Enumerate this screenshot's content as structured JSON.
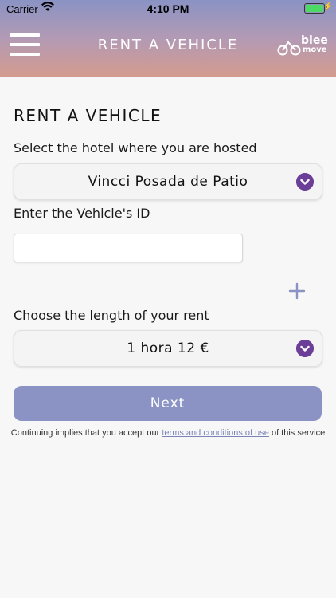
{
  "status_bar": {
    "carrier": "Carrier",
    "time": "4:10 PM",
    "battery_level": 1.0
  },
  "header": {
    "title": "RENT A VEHICLE",
    "logo_text_top": "blee",
    "logo_text_bottom": "move",
    "menu_icon": "hamburger-menu-icon"
  },
  "form": {
    "section_title": "RENT A VEHICLE",
    "hotel_label": "Select the hotel where you are hosted",
    "hotel_value": "Vincci Posada de Patio",
    "vehicle_id_label": "Enter the Vehicle's ID",
    "vehicle_id_value": "",
    "add_icon": "plus-icon",
    "length_label": "Choose the length of your rent",
    "length_value": "1 hora 12 €",
    "next_label": "Next"
  },
  "terms": {
    "prefix": "Continuing implies that you accept our ",
    "link_text": "terms and conditions of use",
    "suffix": " of this service"
  },
  "colors": {
    "accent": "#8a93c4",
    "chevron": "#6b3f97",
    "header_top": "#8a93c4",
    "header_bottom": "#d49b8e"
  }
}
